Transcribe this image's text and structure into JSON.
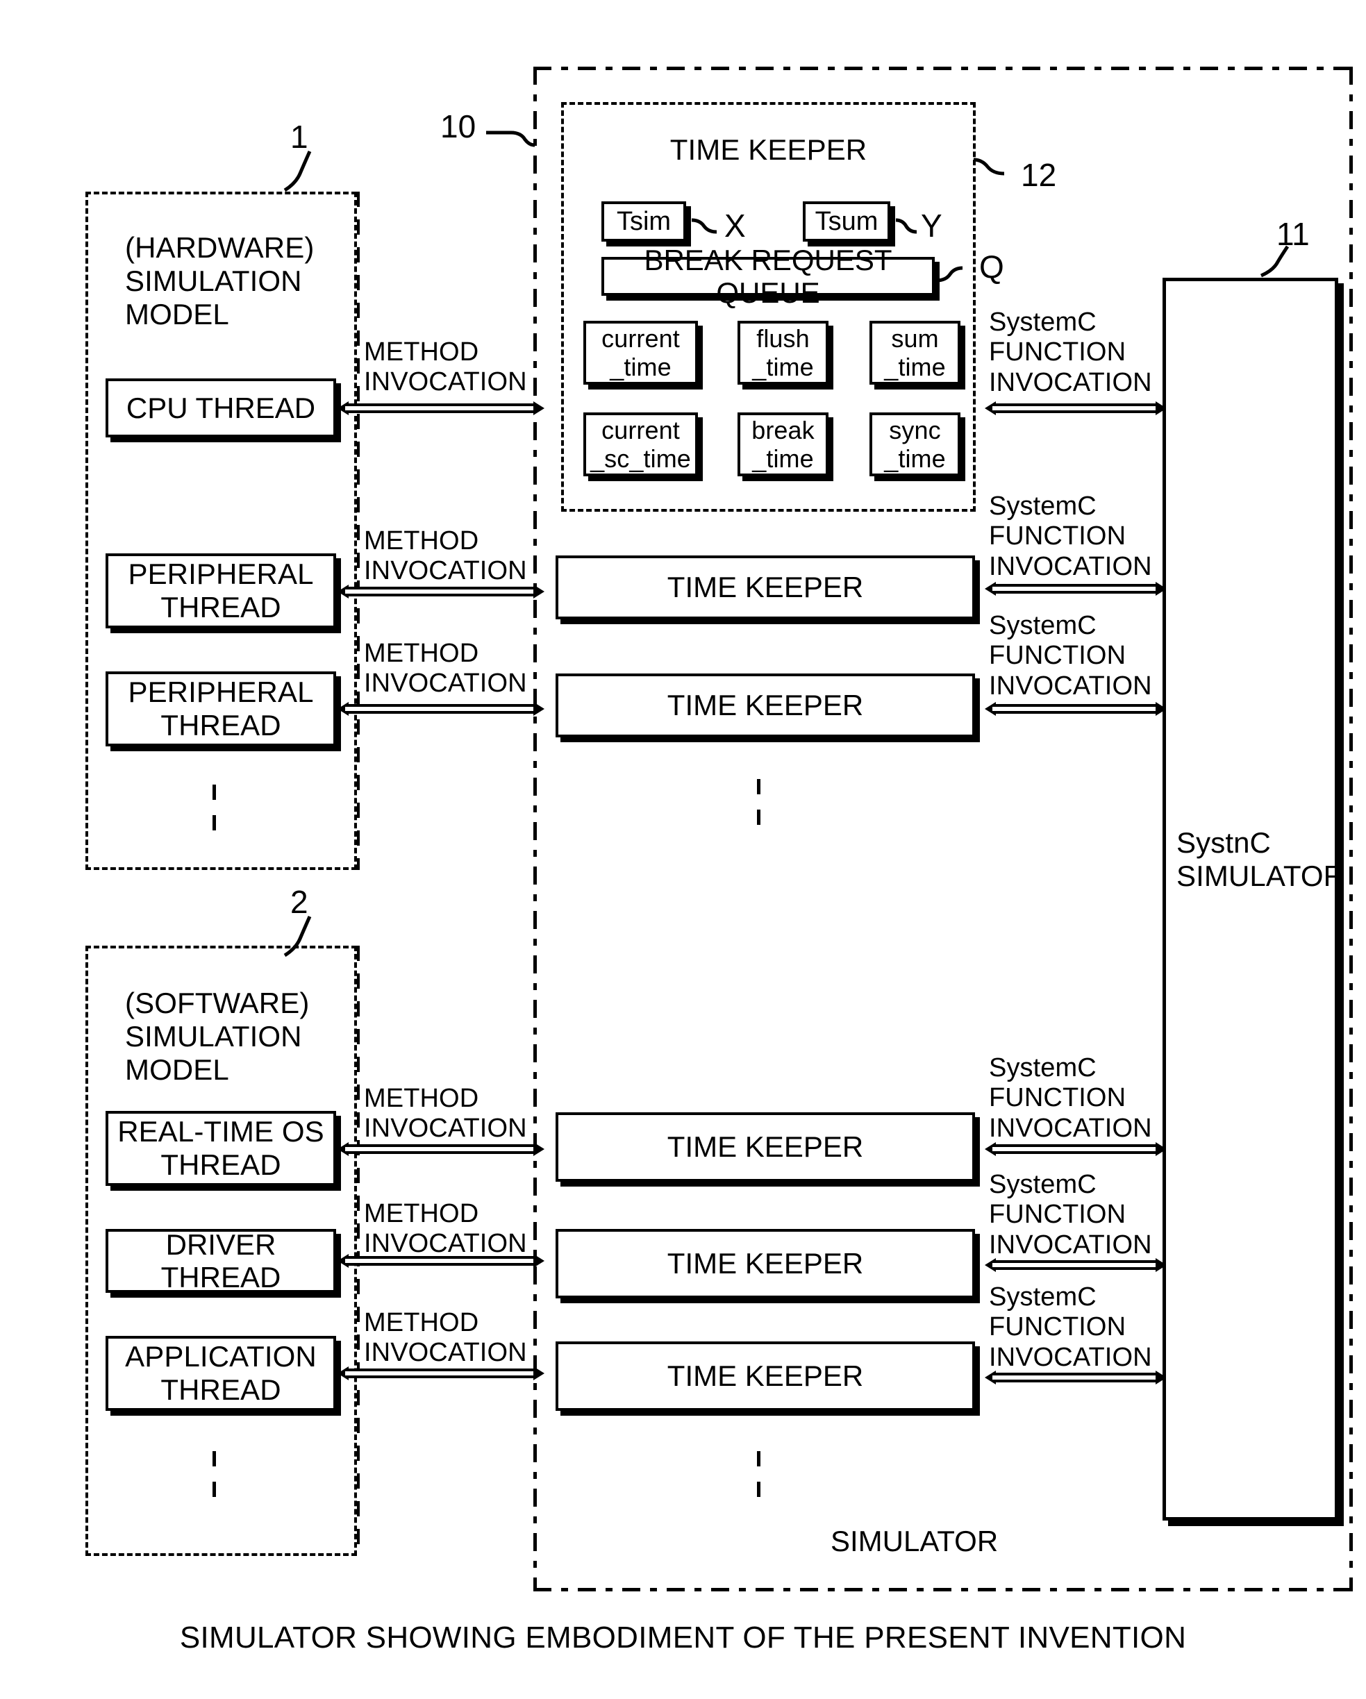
{
  "figure": {
    "caption": "SIMULATOR SHOWING EMBODIMENT OF THE PRESENT INVENTION",
    "simulator_label": "SIMULATOR"
  },
  "refs": {
    "hardware_model": "1",
    "software_model": "2",
    "timekeeper_group": "10",
    "systemc_simulator": "11",
    "timekeeper_detail": "12",
    "tsim_callout": "X",
    "tsum_callout": "Y",
    "queue_callout": "Q"
  },
  "hardware_model": {
    "title": "(HARDWARE)\nSIMULATION\nMODEL",
    "threads": [
      {
        "label": "CPU THREAD"
      },
      {
        "label": "PERIPHERAL\nTHREAD"
      },
      {
        "label": "PERIPHERAL\nTHREAD"
      }
    ]
  },
  "software_model": {
    "title": "(SOFTWARE)\nSIMULATION\nMODEL",
    "threads": [
      {
        "label": "REAL-TIME OS\nTHREAD"
      },
      {
        "label": "DRIVER THREAD"
      },
      {
        "label": "APPLICATION\nTHREAD"
      }
    ]
  },
  "timekeeper_detail": {
    "title": "TIME KEEPER",
    "registers": [
      {
        "label": "Tsim"
      },
      {
        "label": "Tsum"
      }
    ],
    "queue": {
      "label": "BREAK REQUEST QUEUE"
    },
    "functions": [
      {
        "label": "current\n_time"
      },
      {
        "label": "flush\n_time"
      },
      {
        "label": "sum\n_time"
      },
      {
        "label": "current\n_sc_time"
      },
      {
        "label": "break\n_time"
      },
      {
        "label": "sync\n_time"
      }
    ]
  },
  "timekeepers": [
    {
      "label": "TIME KEEPER"
    },
    {
      "label": "TIME KEEPER"
    },
    {
      "label": "TIME KEEPER"
    },
    {
      "label": "TIME KEEPER"
    },
    {
      "label": "TIME KEEPER"
    }
  ],
  "method_invocations": [
    {
      "label": "METHOD\nINVOCATION"
    },
    {
      "label": "METHOD\nINVOCATION"
    },
    {
      "label": "METHOD\nINVOCATION"
    },
    {
      "label": "METHOD\nINVOCATION"
    },
    {
      "label": "METHOD\nINVOCATION"
    },
    {
      "label": "METHOD\nINVOCATION"
    }
  ],
  "function_invocations": [
    {
      "label": "SystemC\nFUNCTION\nINVOCATION"
    },
    {
      "label": "SystemC\nFUNCTION\nINVOCATION"
    },
    {
      "label": "SystemC\nFUNCTION\nINVOCATION"
    },
    {
      "label": "SystemC\nFUNCTION\nINVOCATION"
    },
    {
      "label": "SystemC\nFUNCTION\nINVOCATION"
    },
    {
      "label": "SystemC\nFUNCTION\nINVOCATION"
    }
  ],
  "simulator_core": {
    "label": "SystnC\nSIMULATOR"
  },
  "colors": {
    "ink": "#000000",
    "paper": "#ffffff"
  }
}
